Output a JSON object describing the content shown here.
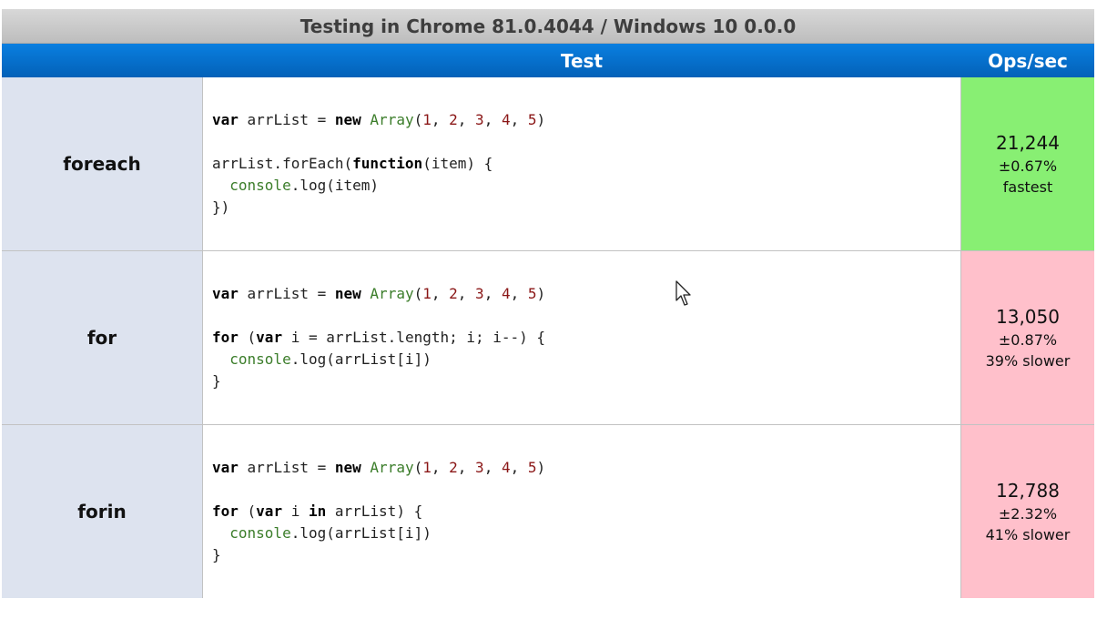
{
  "title": "Testing in Chrome 81.0.4044 / Windows 10 0.0.0",
  "headers": {
    "test": "Test",
    "ops": "Ops/sec"
  },
  "rows": [
    {
      "name": "foreach",
      "ops": "21,244",
      "rme": "±0.67%",
      "rel": "fastest",
      "status": "fastest",
      "code": [
        "var arrList = new Array(1, 2, 3, 4, 5)",
        "",
        "arrList.forEach(function(item) {",
        "  console.log(item)",
        "})"
      ]
    },
    {
      "name": "for",
      "ops": "13,050",
      "rme": "±0.87%",
      "rel": "39% slower",
      "status": "slower",
      "code": [
        "var arrList = new Array(1, 2, 3, 4, 5)",
        "",
        "for (var i = arrList.length; i; i--) {",
        "  console.log(arrList[i])",
        "}"
      ]
    },
    {
      "name": "forin",
      "ops": "12,788",
      "rme": "±2.32%",
      "rel": "41% slower",
      "status": "slower",
      "code": [
        "var arrList = new Array(1, 2, 3, 4, 5)",
        "",
        "for (var i in arrList) {",
        "  console.log(arrList[i])",
        "}"
      ]
    }
  ],
  "colors": {
    "fastest": "#88ef73",
    "slower": "#ffc0cb",
    "header_blue": "#0a7fe0",
    "name_cell": "#dde3ef"
  },
  "icons": {
    "cursor": "mouse-pointer-icon"
  }
}
